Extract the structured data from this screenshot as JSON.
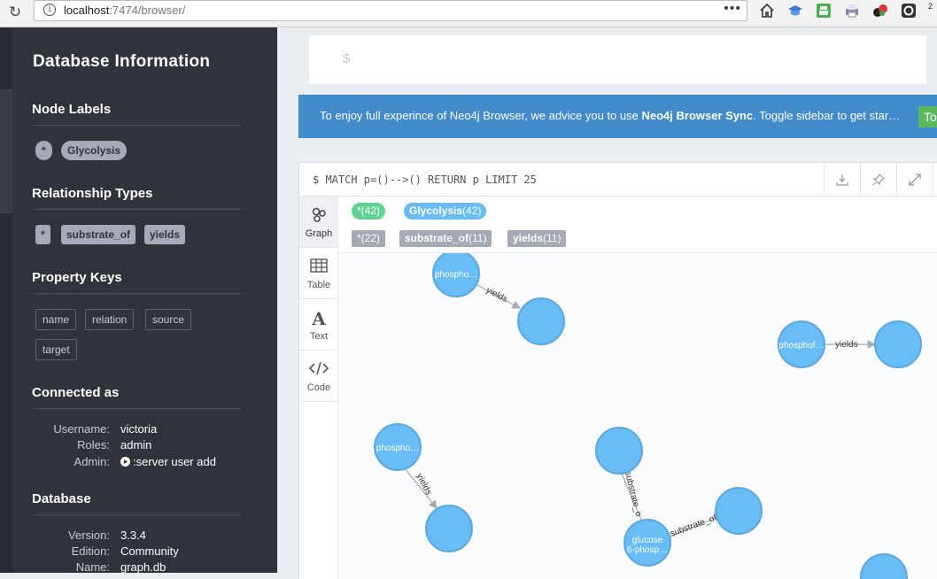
{
  "browser": {
    "url_host": "localhost",
    "url_rest": ":7474/browser/",
    "menu_dots": "•••",
    "badge": "2"
  },
  "sidebar": {
    "title": "Database Information",
    "node_labels_heading": "Node Labels",
    "node_labels": [
      "*",
      "Glycolysis"
    ],
    "relationship_types_heading": "Relationship Types",
    "relationship_types": [
      "*",
      "substrate_of",
      "yields"
    ],
    "property_keys_heading": "Property Keys",
    "property_keys": [
      "name",
      "relation",
      "source",
      "target"
    ],
    "connected_heading": "Connected as",
    "connected": {
      "username_label": "Username:",
      "username": "victoria",
      "roles_label": "Roles:",
      "roles": "admin",
      "admin_label": "Admin:",
      "admin_cmd": ":server user add"
    },
    "database_heading": "Database",
    "database": {
      "version_label": "Version:",
      "version": "3.3.4",
      "edition_label": "Edition:",
      "edition": "Community",
      "name_label": "Name:",
      "name": "graph.db"
    }
  },
  "editor": {
    "prompt": "$"
  },
  "banner": {
    "text_before": "To enjoy full experince of Neo4j Browser, we advice you to use ",
    "text_bold": "Neo4j Browser Sync",
    "text_after": ". Toggle sidebar to get star…",
    "button": "To"
  },
  "frame": {
    "query": "$ MATCH p=()-->() RETURN p LIMIT 25",
    "tabs": [
      "Graph",
      "Table",
      "Text",
      "Code"
    ],
    "legend_nodes": [
      {
        "name": "*",
        "count": "(42)",
        "color": "#5fd38f"
      },
      {
        "name": "Glycolysis",
        "count": "(42)",
        "color": "#68bdf6"
      }
    ],
    "legend_rels": [
      {
        "name": "*",
        "count": "(22)"
      },
      {
        "name": "substrate_of",
        "count": "(11)"
      },
      {
        "name": "yields",
        "count": "(11)"
      }
    ]
  },
  "graph": {
    "node_color": "#68bdf6",
    "node_stroke": "#5ca8db",
    "node_labels": [
      "phospho…",
      "phosphof…",
      "phospho…",
      "glucose",
      "6-phosp…"
    ],
    "rel_labels": [
      "yields",
      "yields",
      "yields",
      "substrate_o",
      "substrate_of"
    ]
  }
}
